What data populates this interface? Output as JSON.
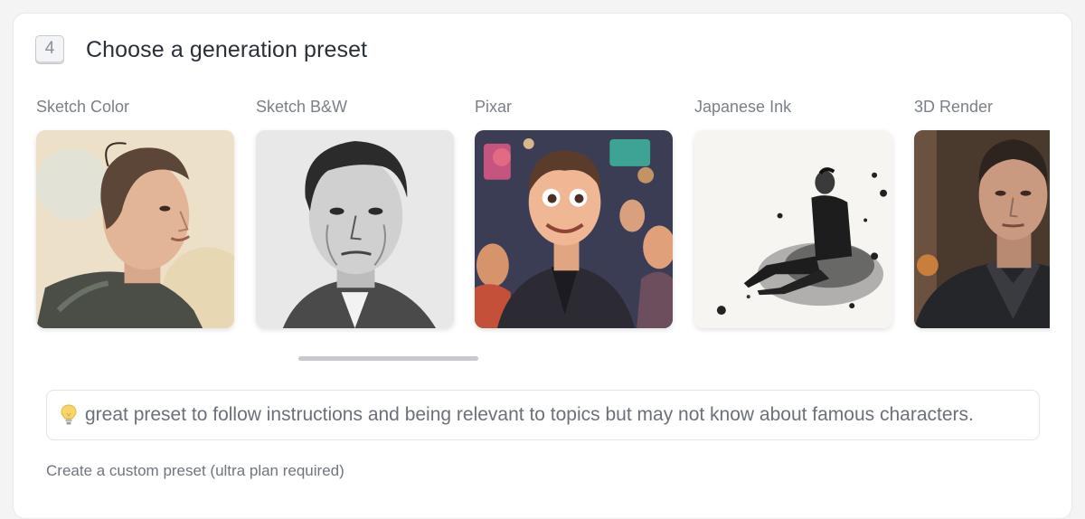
{
  "section": {
    "step_number": "4",
    "title": "Choose a generation preset"
  },
  "presets": [
    {
      "label": "Sketch Color"
    },
    {
      "label": "Sketch B&W"
    },
    {
      "label": "Pixar"
    },
    {
      "label": "Japanese Ink"
    },
    {
      "label": "3D Render"
    }
  ],
  "info": {
    "icon": "lightbulb-icon",
    "text": "great preset to follow instructions and being relevant to topics but may not know about famous characters."
  },
  "custom_link": "Create a custom preset (ultra plan required)",
  "colors": {
    "card_bg": "#ffffff",
    "page_bg": "#f4f4f5",
    "text_primary": "#2a2f3a",
    "text_muted": "#7b8088"
  }
}
